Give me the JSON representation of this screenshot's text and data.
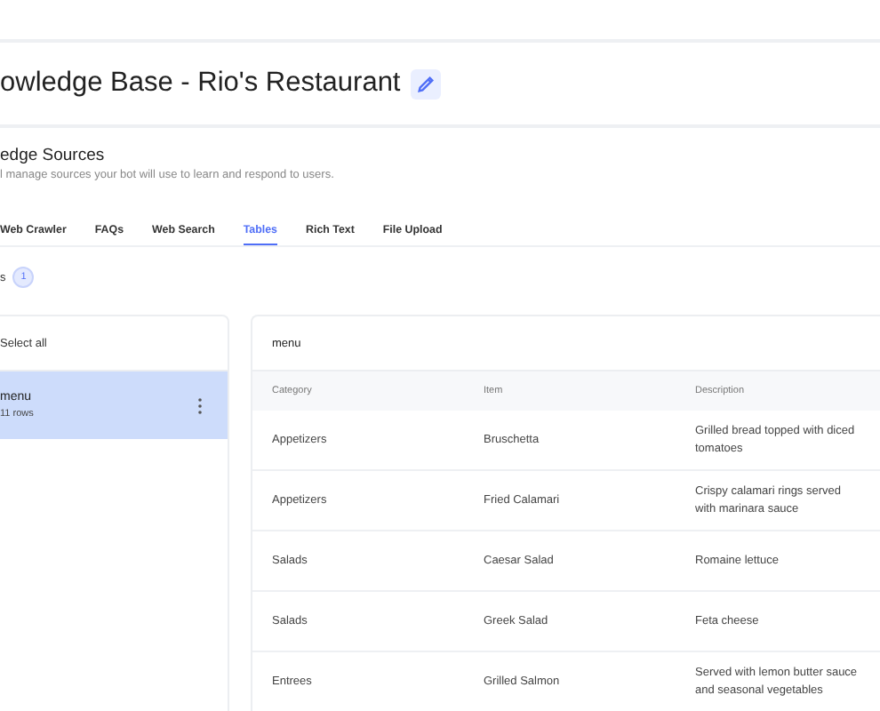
{
  "title": "owledge Base - Rio's Restaurant",
  "section": {
    "title": "edge Sources",
    "subtitle": "l manage sources your bot will use to learn and respond to users."
  },
  "tabs": [
    {
      "label": "Web Crawler",
      "selected": false
    },
    {
      "label": "FAQs",
      "selected": false
    },
    {
      "label": "Web Search",
      "selected": false
    },
    {
      "label": "Tables",
      "selected": true
    },
    {
      "label": "Rich Text",
      "selected": false
    },
    {
      "label": "File Upload",
      "selected": false
    }
  ],
  "count_label": "s",
  "count": "1",
  "sidebar": {
    "select_all": "Select all",
    "items": [
      {
        "name": "menu",
        "rows": "11 rows",
        "selected": true
      }
    ]
  },
  "table": {
    "name": "menu",
    "columns": [
      "Category",
      "Item",
      "Description"
    ],
    "rows": [
      [
        "Appetizers",
        "Bruschetta",
        "Grilled bread topped with diced tomatoes"
      ],
      [
        "Appetizers",
        "Fried Calamari",
        "Crispy calamari rings served with marinara sauce"
      ],
      [
        "Salads",
        "Caesar Salad",
        "Romaine lettuce"
      ],
      [
        "Salads",
        "Greek Salad",
        "Feta cheese"
      ],
      [
        "Entrees",
        "Grilled Salmon",
        "Served with lemon butter sauce and seasonal vegetables"
      ]
    ]
  }
}
